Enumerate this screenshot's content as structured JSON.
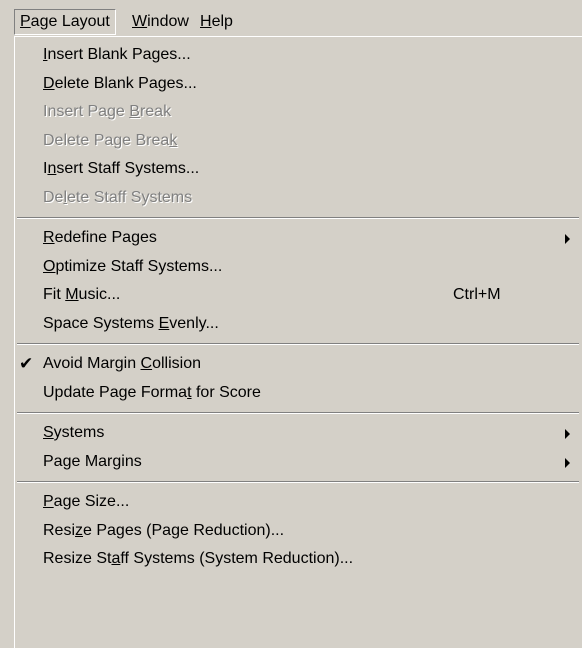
{
  "menubar": {
    "items": [
      {
        "label": "Page Layout",
        "mnemonic": "P"
      },
      {
        "label": "Window",
        "mnemonic": "W"
      },
      {
        "label": "Help",
        "mnemonic": "H"
      }
    ]
  },
  "menu": {
    "groups": [
      [
        {
          "label": "Insert Blank Pages...",
          "mnemonic_index": 0,
          "enabled": true
        },
        {
          "label": "Delete Blank Pages...",
          "mnemonic_index": 0,
          "enabled": true
        },
        {
          "label": "Insert Page Break",
          "mnemonic_index": 12,
          "enabled": false
        },
        {
          "label": "Delete Page Break",
          "mnemonic_index": 16,
          "enabled": false
        },
        {
          "label": "Insert Staff Systems...",
          "mnemonic_index": 1,
          "enabled": true
        },
        {
          "label": "Delete Staff Systems",
          "mnemonic_index": 2,
          "enabled": false
        }
      ],
      [
        {
          "label": "Redefine Pages",
          "mnemonic_index": 0,
          "enabled": true,
          "submenu": true
        },
        {
          "label": "Optimize Staff Systems...",
          "mnemonic_index": 0,
          "enabled": true
        },
        {
          "label": "Fit Music...",
          "mnemonic_index": 4,
          "enabled": true,
          "shortcut": "Ctrl+M"
        },
        {
          "label": "Space Systems Evenly...",
          "mnemonic_index": 14,
          "enabled": true
        }
      ],
      [
        {
          "label": "Avoid Margin Collision",
          "mnemonic_index": 13,
          "enabled": true,
          "checked": true
        },
        {
          "label": "Update Page Format for Score",
          "mnemonic_index": 17,
          "enabled": true
        }
      ],
      [
        {
          "label": "Systems",
          "mnemonic_index": 0,
          "enabled": true,
          "submenu": true
        },
        {
          "label": "Page Margins",
          "mnemonic_index": -1,
          "enabled": true,
          "submenu": true
        }
      ],
      [
        {
          "label": "Page Size...",
          "mnemonic_index": 0,
          "enabled": true
        },
        {
          "label": "Resize Pages (Page Reduction)...",
          "mnemonic_index": 4,
          "enabled": true
        },
        {
          "label": "Resize Staff Systems (System Reduction)...",
          "mnemonic_index": 9,
          "enabled": true
        }
      ]
    ]
  },
  "icons": {
    "check": "check-icon",
    "submenu": "submenu-arrow-icon"
  }
}
